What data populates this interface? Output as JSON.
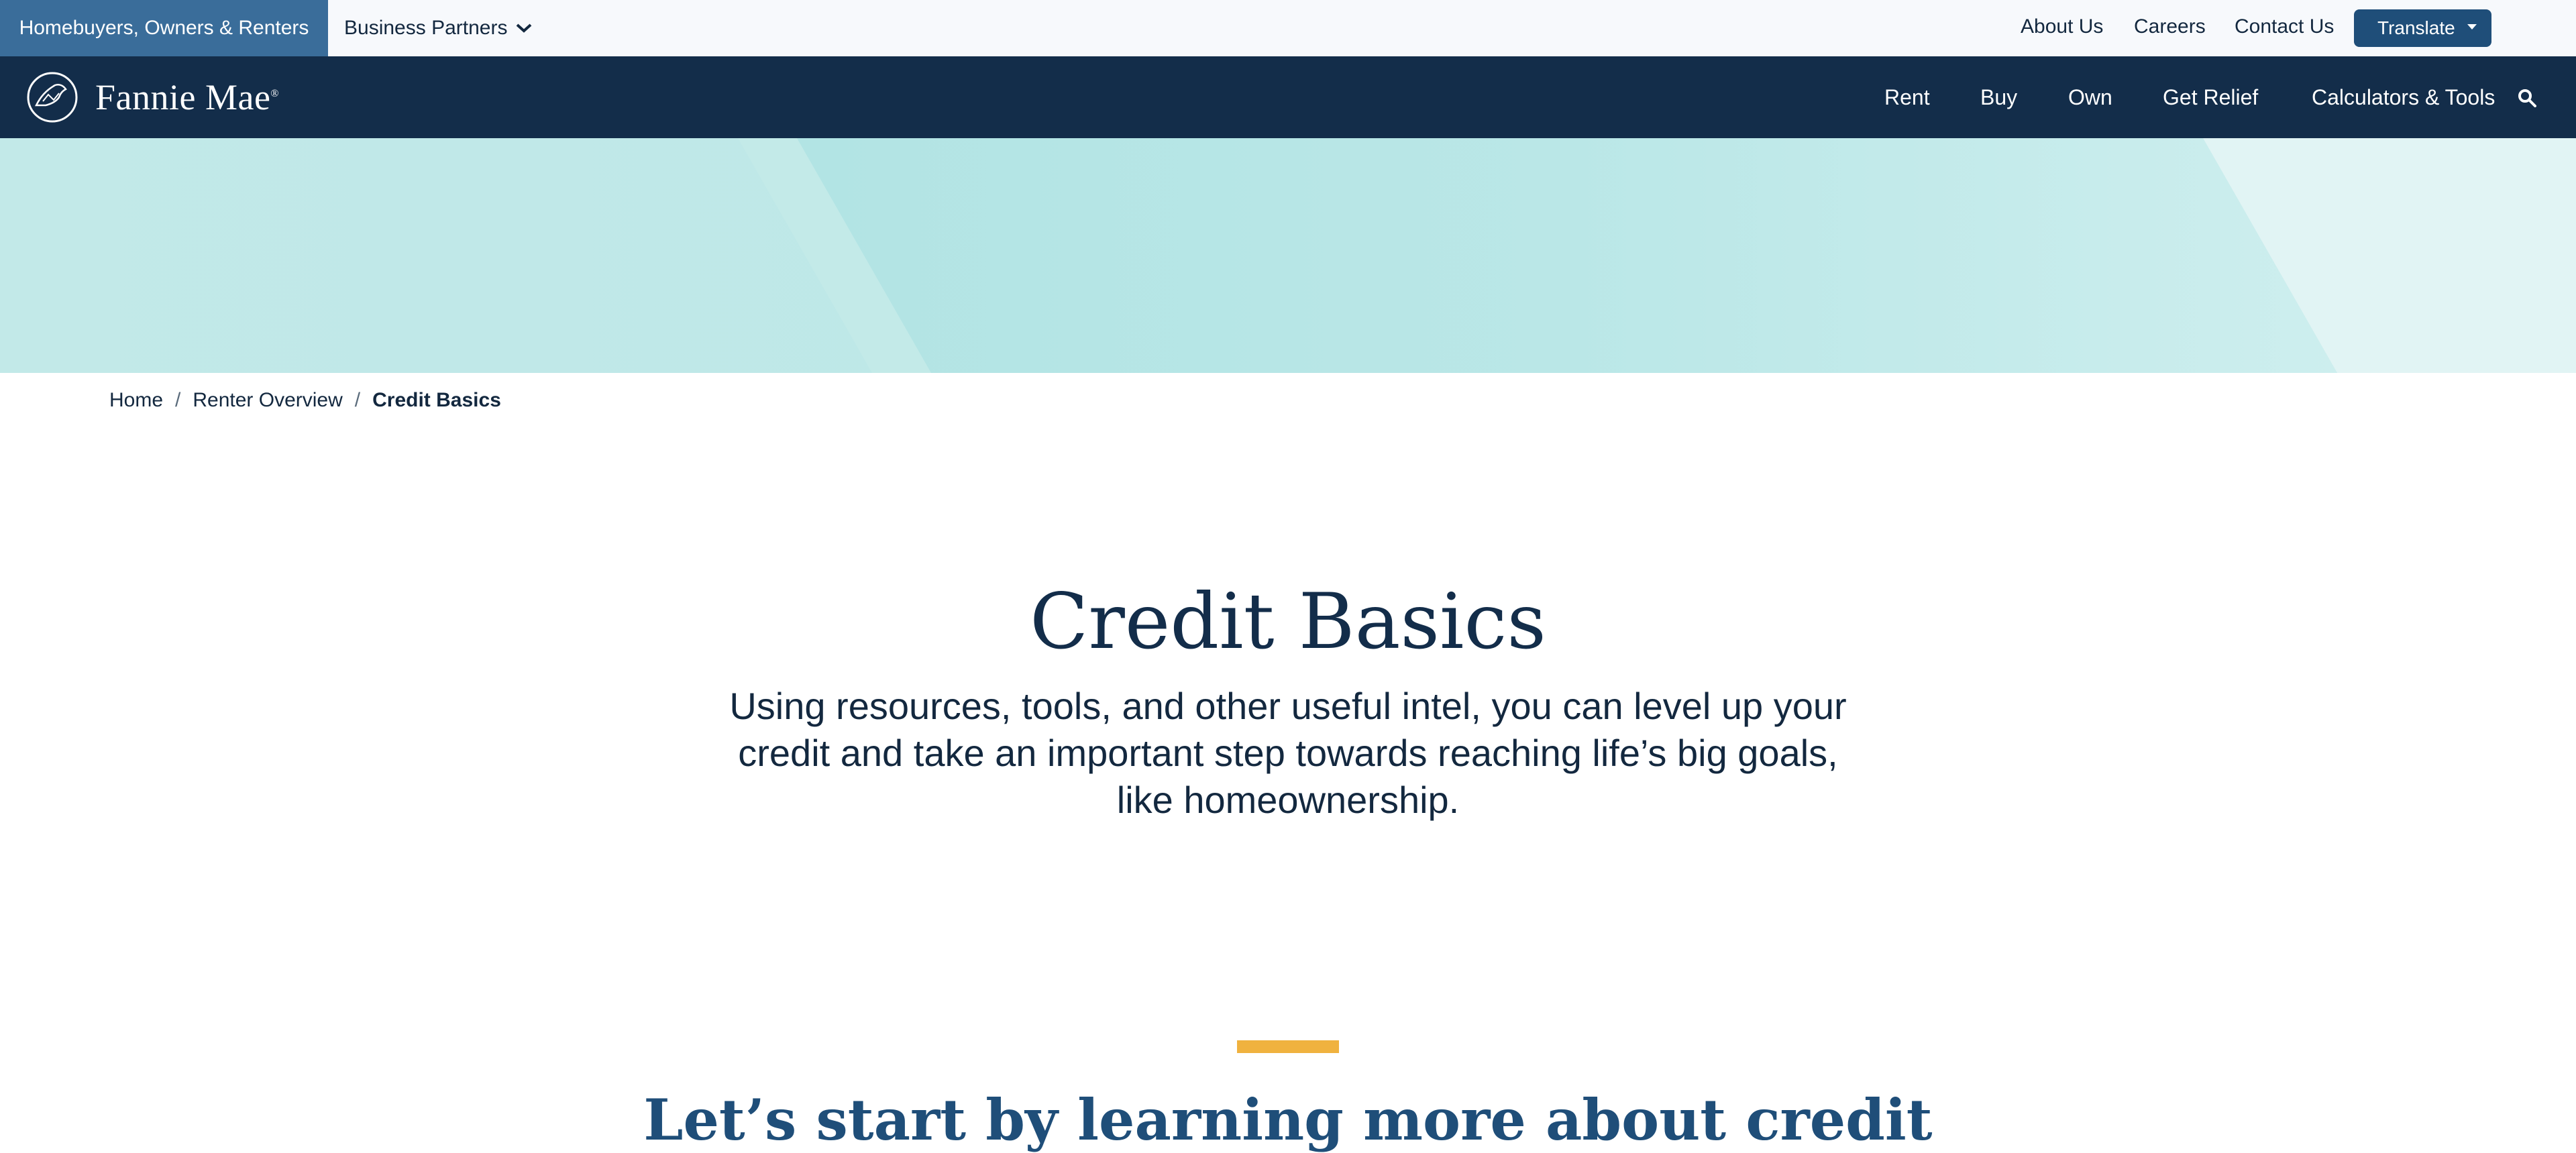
{
  "utility_bar": {
    "audience_active": "Homebuyers, Owners & Renters",
    "audience_other": "Business Partners",
    "links": [
      "About Us",
      "Careers",
      "Contact Us"
    ],
    "translate_label": "Translate"
  },
  "main_nav": {
    "logo_text": "Fannie Mae",
    "logo_mark": "®",
    "items": [
      "Rent",
      "Buy",
      "Own",
      "Get Relief",
      "Calculators & Tools"
    ],
    "search_icon": "search-icon"
  },
  "breadcrumb": {
    "items": [
      "Home",
      "Renter Overview"
    ],
    "current": "Credit Basics",
    "separator": "/"
  },
  "hero": {
    "title": "Credit Basics",
    "intro": "Using resources, tools, and other useful intel, you can level up your credit and take an important step towards reaching life’s big goals, like homeownership."
  },
  "section": {
    "title": "Let’s start by learning more about credit"
  },
  "colors": {
    "navy": "#132d4a",
    "active_tab": "#3a6d9a",
    "translate_button": "#1f4e79",
    "accent": "#f0b23f",
    "hero_teal": "#b2e4e4"
  }
}
